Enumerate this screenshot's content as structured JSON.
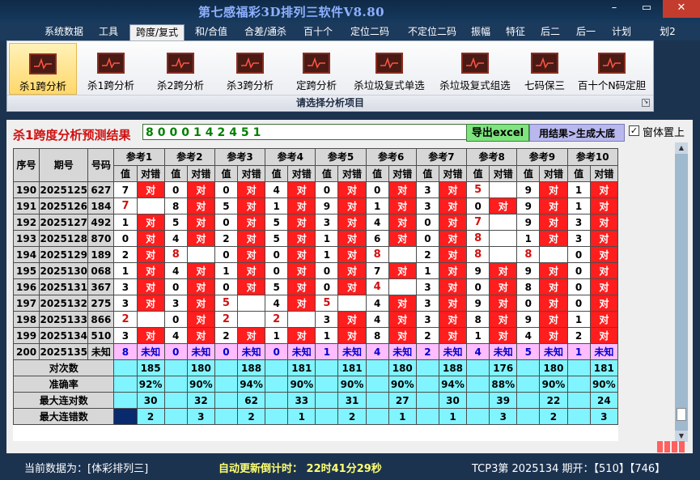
{
  "window": {
    "title": "第七感福彩3D排列三软件V8.80",
    "controls": {
      "minimize": "–",
      "restore": "▭",
      "close": "✕"
    }
  },
  "menu": [
    "系统数据",
    "工具",
    "跨度/复式",
    "和/合值",
    "合差/通杀",
    "百十个",
    "定位二码",
    "不定位二码",
    "振幅",
    "特征",
    "后二",
    "后一",
    "计划",
    "划2"
  ],
  "menu_active_index": 2,
  "ribbon": {
    "items": [
      "杀1跨分析",
      "杀1跨分析",
      "杀2跨分析",
      "杀3跨分析",
      "定跨分析",
      "杀垃圾复式单选",
      "杀垃圾复式组选",
      "七码保三",
      "百十个N码定胆"
    ],
    "active_index": 0,
    "caption": "请选择分析项目"
  },
  "panel": {
    "title": "杀1跨度分析预测结果",
    "result_value": "8000142451",
    "excel_button": "导出excel",
    "generate_button": "用结果>生成大底",
    "checkbox_label": "窗体置上",
    "checkbox_checked": true
  },
  "table": {
    "headers": {
      "idx": "序号",
      "period": "期号",
      "number": "号码",
      "refs": [
        "参考1",
        "参考2",
        "参考3",
        "参考4",
        "参考5",
        "参考6",
        "参考7",
        "参考8",
        "参考9",
        "参考10"
      ],
      "sub_value": "值",
      "sub_result": "对错"
    },
    "hit_text": "对",
    "rows": [
      {
        "idx": "190",
        "period": "2025125",
        "num": "627",
        "cells": [
          [
            "7",
            "对"
          ],
          [
            "0",
            "对"
          ],
          [
            "0",
            "对"
          ],
          [
            "4",
            "对"
          ],
          [
            "0",
            "对"
          ],
          [
            "0",
            "对"
          ],
          [
            "3",
            "对"
          ],
          [
            "5",
            ""
          ],
          [
            "9",
            "对"
          ],
          [
            "1",
            "对"
          ]
        ],
        "red": [
          7
        ]
      },
      {
        "idx": "191",
        "period": "2025126",
        "num": "184",
        "cells": [
          [
            "7",
            ""
          ],
          [
            "8",
            "对"
          ],
          [
            "5",
            "对"
          ],
          [
            "1",
            "对"
          ],
          [
            "9",
            "对"
          ],
          [
            "1",
            "对"
          ],
          [
            "3",
            "对"
          ],
          [
            "0",
            "对"
          ],
          [
            "9",
            "对"
          ],
          [
            "1",
            "对"
          ]
        ],
        "red": [
          0
        ]
      },
      {
        "idx": "192",
        "period": "2025127",
        "num": "492",
        "cells": [
          [
            "1",
            "对"
          ],
          [
            "5",
            "对"
          ],
          [
            "0",
            "对"
          ],
          [
            "5",
            "对"
          ],
          [
            "3",
            "对"
          ],
          [
            "4",
            "对"
          ],
          [
            "0",
            "对"
          ],
          [
            "7",
            ""
          ],
          [
            "9",
            "对"
          ],
          [
            "3",
            "对"
          ]
        ],
        "red": [
          7
        ]
      },
      {
        "idx": "193",
        "period": "2025128",
        "num": "870",
        "cells": [
          [
            "0",
            "对"
          ],
          [
            "4",
            "对"
          ],
          [
            "2",
            "对"
          ],
          [
            "5",
            "对"
          ],
          [
            "1",
            "对"
          ],
          [
            "6",
            "对"
          ],
          [
            "0",
            "对"
          ],
          [
            "8",
            ""
          ],
          [
            "1",
            "对"
          ],
          [
            "3",
            "对"
          ]
        ],
        "red": [
          7
        ]
      },
      {
        "idx": "194",
        "period": "2025129",
        "num": "189",
        "cells": [
          [
            "2",
            "对"
          ],
          [
            "8",
            ""
          ],
          [
            "0",
            "对"
          ],
          [
            "0",
            "对"
          ],
          [
            "1",
            "对"
          ],
          [
            "8",
            ""
          ],
          [
            "2",
            "对"
          ],
          [
            "8",
            ""
          ],
          [
            "8",
            ""
          ],
          [
            "0",
            "对"
          ]
        ],
        "red": [
          1,
          5,
          7,
          8
        ]
      },
      {
        "idx": "195",
        "period": "2025130",
        "num": "068",
        "cells": [
          [
            "1",
            "对"
          ],
          [
            "4",
            "对"
          ],
          [
            "1",
            "对"
          ],
          [
            "0",
            "对"
          ],
          [
            "0",
            "对"
          ],
          [
            "7",
            "对"
          ],
          [
            "1",
            "对"
          ],
          [
            "9",
            "对"
          ],
          [
            "9",
            "对"
          ],
          [
            "0",
            "对"
          ]
        ],
        "red": []
      },
      {
        "idx": "196",
        "period": "2025131",
        "num": "367",
        "cells": [
          [
            "3",
            "对"
          ],
          [
            "0",
            "对"
          ],
          [
            "0",
            "对"
          ],
          [
            "5",
            "对"
          ],
          [
            "0",
            "对"
          ],
          [
            "4",
            ""
          ],
          [
            "3",
            "对"
          ],
          [
            "0",
            "对"
          ],
          [
            "8",
            "对"
          ],
          [
            "0",
            "对"
          ]
        ],
        "red": [
          5
        ]
      },
      {
        "idx": "197",
        "period": "2025132",
        "num": "275",
        "cells": [
          [
            "3",
            "对"
          ],
          [
            "3",
            "对"
          ],
          [
            "5",
            ""
          ],
          [
            "4",
            "对"
          ],
          [
            "5",
            ""
          ],
          [
            "4",
            "对"
          ],
          [
            "3",
            "对"
          ],
          [
            "9",
            "对"
          ],
          [
            "0",
            "对"
          ],
          [
            "0",
            "对"
          ]
        ],
        "red": [
          2,
          4
        ]
      },
      {
        "idx": "198",
        "period": "2025133",
        "num": "866",
        "cells": [
          [
            "2",
            ""
          ],
          [
            "0",
            "对"
          ],
          [
            "2",
            ""
          ],
          [
            "2",
            ""
          ],
          [
            "3",
            "对"
          ],
          [
            "4",
            "对"
          ],
          [
            "3",
            "对"
          ],
          [
            "8",
            "对"
          ],
          [
            "9",
            "对"
          ],
          [
            "1",
            "对"
          ]
        ],
        "red": [
          0,
          2,
          3
        ]
      },
      {
        "idx": "199",
        "period": "2025134",
        "num": "510",
        "cells": [
          [
            "3",
            "对"
          ],
          [
            "4",
            "对"
          ],
          [
            "2",
            "对"
          ],
          [
            "1",
            "对"
          ],
          [
            "1",
            "对"
          ],
          [
            "8",
            "对"
          ],
          [
            "2",
            "对"
          ],
          [
            "1",
            "对"
          ],
          [
            "4",
            "对"
          ],
          [
            "2",
            "对"
          ]
        ],
        "red": []
      }
    ],
    "predict_row": {
      "idx": "200",
      "period": "2025135",
      "num": "未知",
      "values": [
        "8",
        "0",
        "0",
        "0",
        "1",
        "4",
        "2",
        "4",
        "5",
        "1"
      ],
      "result": "未知"
    },
    "stats": [
      {
        "label": "对次数",
        "values": [
          "185",
          "180",
          "188",
          "181",
          "181",
          "180",
          "188",
          "176",
          "180",
          "181"
        ]
      },
      {
        "label": "准确率",
        "values": [
          "92%",
          "90%",
          "94%",
          "90%",
          "90%",
          "90%",
          "94%",
          "88%",
          "90%",
          "90%"
        ]
      },
      {
        "label": "最大连对数",
        "values": [
          "30",
          "32",
          "62",
          "33",
          "31",
          "27",
          "30",
          "39",
          "22",
          "24"
        ]
      },
      {
        "label": "最大连错数",
        "values": [
          "2",
          "3",
          "2",
          "1",
          "2",
          "1",
          "1",
          "3",
          "2",
          "3"
        ]
      }
    ]
  },
  "status": {
    "current_data": "当前数据为：[体彩排列三]",
    "countdown": "自动更新倒计时：  22时41分29秒",
    "info": "TCP3第 2025134 期开：【510】【746】"
  }
}
